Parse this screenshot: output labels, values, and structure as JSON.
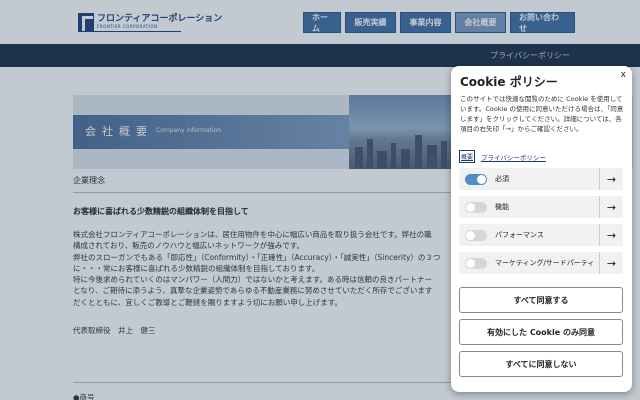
{
  "header": {
    "logo_jp": "フロンティアコーポレーション",
    "logo_en": "FRONTIER CORPORATION",
    "nav": [
      "ホーム",
      "販売実績",
      "事業内容",
      "会社概要",
      "お問い合わせ"
    ],
    "active_nav": "会社概要",
    "privacy_link": "プライバシーポリシー"
  },
  "banner": {
    "title": "会社概要",
    "subtitle": "Company information"
  },
  "main": {
    "section_heading": "企業理念",
    "slogan": "お客様に喜ばれる少数精鋭の組織体制を目指して",
    "paragraph_lines": [
      "株式会社フロンティアコーポレーションは、居住用物件を中心に幅広い商品を取り扱う会社です。弊社の職",
      "構成されており、販売のノウハウと幅広いネットワークが強みです。",
      "弊社のスローガンでもある「即応性」（Conformity）・「正確性」（Accuracy）・「誠実性」（Sincerity）の３つ",
      "に・・・常にお客様に喜ばれる少数精鋭の組織体制を目指しております。",
      "特に今後求められていくのはマンパワー（人間力）ではないかと考えます。ある時は信頼の良きパートナー",
      "となり、ご期待に添うよう、真摯な企業姿勢であらゆる不動産業務に努めさせていただく所存でございます",
      "だくとともに、宜しくご教導とご鞭撻を賜りますよう切にお願い申し上げます。"
    ],
    "signature": "代表取締役　井上　健三",
    "next_heading": "●商号"
  },
  "cookie": {
    "title": "Cookie ポリシー",
    "close": "x",
    "description": "このサイトでは快適な閲覧のために Cookie を使用しています。Cookie の使用に同意いただける場合は、「同意します」をクリックしてください。詳細については、各項目の右矢印「→」からご確認ください。",
    "more_link": "概要",
    "policy_link": "プライバシーポリシー",
    "preferences": [
      {
        "label": "必須",
        "on": true
      },
      {
        "label": "機能",
        "on": false
      },
      {
        "label": "パフォーマンス",
        "on": false
      },
      {
        "label": "マーケティング/サードパーティ",
        "on": false
      }
    ],
    "arrow": "→",
    "buttons": [
      "すべて同意する",
      "有効にした Cookie のみ同意",
      "すべてに同意しない"
    ]
  },
  "colors": {
    "nav_bg": "#3f6fa5",
    "subbar_bg": "#1b2f4a",
    "toggle_on": "#4e8ec7"
  }
}
